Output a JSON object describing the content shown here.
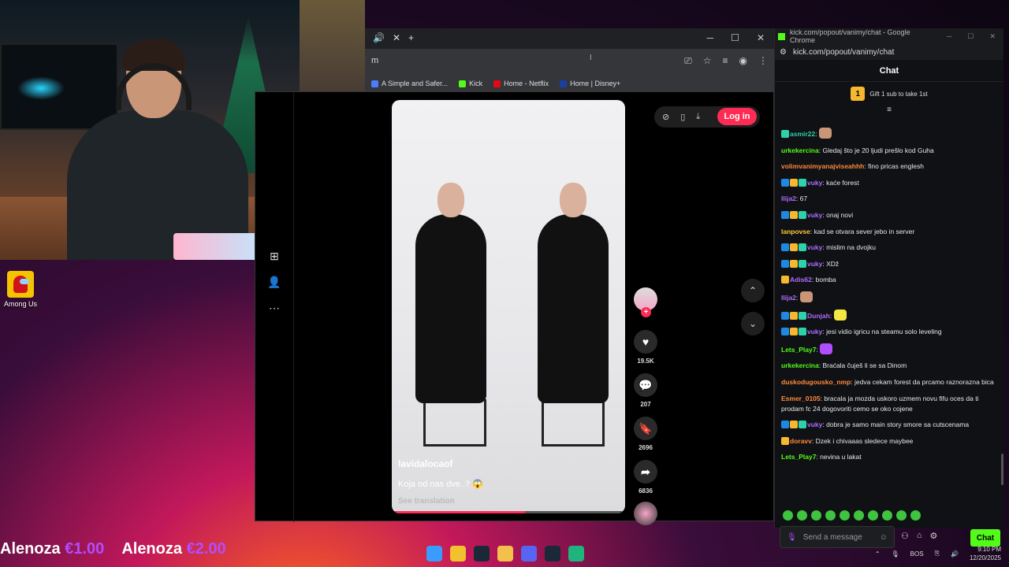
{
  "desktop": {
    "icon_label": "Among Us"
  },
  "chrome": {
    "url_fragment": "m",
    "bookmarks": [
      {
        "label": "A Simple and Safer...",
        "color": "#4f7cff"
      },
      {
        "label": "Kick",
        "color": "#53fc18"
      },
      {
        "label": "Home - Netflix",
        "color": "#e50914"
      },
      {
        "label": "Home | Disney+",
        "color": "#1b3fa0"
      }
    ]
  },
  "tiktok": {
    "login_label": "Log in",
    "username": "lavidalocaof",
    "caption": "Koja od nas dve..? 😱",
    "see_translation": "See translation",
    "likes": "19.5K",
    "comments": "207",
    "saves": "2696",
    "shares": "6836",
    "progress_fraction": 0.57
  },
  "kick": {
    "window_title": "kick.com/popout/vanimy/chat - Google Chrome",
    "url": "kick.com/popout/vanimy/chat",
    "header": "Chat",
    "gift_count": "1",
    "gift_text": "Gift 1 sub to take 1st",
    "messages": [
      {
        "user": "asmir22",
        "color": "#2ed1a8",
        "text": "",
        "badges": [
          "green"
        ],
        "emote": "#c99678"
      },
      {
        "user": "urkekercina",
        "color": "#53fc18",
        "text": "Gledaj što je 20 ljudi prešlo kod Guha",
        "badges": []
      },
      {
        "user": "volimvanimyanajviseahhh",
        "color": "#ff8a3d",
        "text": "fino pricas englesh",
        "badges": []
      },
      {
        "user": "vuky",
        "color": "#b06bff",
        "text": "kaće forest",
        "badges": [
          "blue",
          "gold",
          "green"
        ]
      },
      {
        "user": "Ilija2",
        "color": "#b06bff",
        "text": "67",
        "badges": []
      },
      {
        "user": "vuky",
        "color": "#b06bff",
        "text": "onaj novi",
        "badges": [
          "blue",
          "gold",
          "green"
        ]
      },
      {
        "user": "lanpovse",
        "color": "#ffc940",
        "text": "kad se otvara sever jebo in server",
        "badges": []
      },
      {
        "user": "vuky",
        "color": "#b06bff",
        "text": "mislim na dvojku",
        "badges": [
          "blue",
          "gold",
          "green"
        ]
      },
      {
        "user": "vuky",
        "color": "#b06bff",
        "text": "XDž",
        "badges": [
          "blue",
          "gold",
          "green"
        ]
      },
      {
        "user": "Adis62",
        "color": "#b06bff",
        "text": "bomba",
        "badges": [
          "gold"
        ]
      },
      {
        "user": "Ilija2",
        "color": "#b06bff",
        "text": "",
        "badges": [],
        "emote": "#c99678"
      },
      {
        "user": "Dunjah",
        "color": "#b06bff",
        "text": "",
        "badges": [
          "blue",
          "gold",
          "green"
        ],
        "emote": "#f5e642"
      },
      {
        "user": "vuky",
        "color": "#b06bff",
        "text": "jesi vidio igricu na steamu solo leveling",
        "badges": [
          "blue",
          "gold",
          "green"
        ]
      },
      {
        "user": "Lets_Play7",
        "color": "#53fc18",
        "text": "",
        "badges": [],
        "emote": "#b04dff"
      },
      {
        "user": "urkekercina",
        "color": "#53fc18",
        "text": "Braćala čuješ li se sa Dinom",
        "badges": []
      },
      {
        "user": "duskodugousko_nmp",
        "color": "#ff8a3d",
        "text": "jedva cekam forest da prcamo raznorazna bica",
        "badges": []
      },
      {
        "user": "Esmer_0105",
        "color": "#ff8a3d",
        "text": "bracala ja mozda uskoro uzmem novu fifu oces da ti prodam fc 24 dogovoriti cemo se oko cojene",
        "badges": []
      },
      {
        "user": "vuky",
        "color": "#b06bff",
        "text": "dobra je samo main story smore sa cutscenama",
        "badges": [
          "blue",
          "gold",
          "green"
        ]
      },
      {
        "user": "doravv",
        "color": "#ff8a3d",
        "text": "Dzek i chivaaas sledece maybee",
        "badges": [
          "gold"
        ]
      },
      {
        "user": "Lets_Play7",
        "color": "#53fc18",
        "text": "nevina u lakat",
        "badges": []
      }
    ],
    "input_placeholder": "Send a message",
    "send_label": "Chat"
  },
  "alerts": [
    {
      "name": "Alenoza",
      "amount": "€1.00"
    },
    {
      "name": "Alenoza",
      "amount": "€2.00"
    }
  ],
  "taskbar": {
    "lang": "BOS",
    "time": "9:10 PM",
    "date": "12/20/2025",
    "apps": [
      "#3a9cff",
      "#f2c12e",
      "#1b2838",
      "#f3c04b",
      "#5865f2",
      "#1b2838",
      "#1fb37d"
    ]
  }
}
